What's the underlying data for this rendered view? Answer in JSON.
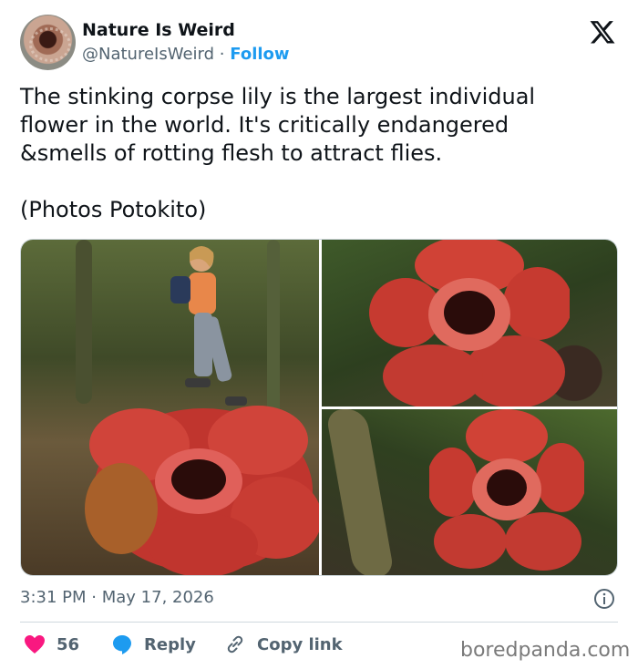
{
  "header": {
    "name": "Nature Is Weird",
    "handle": "@NatureIsWeird",
    "separator": "·",
    "follow_label": "Follow",
    "platform_icon": "x-logo-icon"
  },
  "tweet": {
    "lines": [
      "The stinking corpse lily is the largest individual",
      "flower in the world. It's critically endangered",
      "&smells of rotting flesh to attract flies."
    ],
    "credit": "(Photos Potokito)"
  },
  "media": {
    "photos": [
      {
        "icon": "rafflesia-with-woman-photo"
      },
      {
        "icon": "rafflesia-top-photo"
      },
      {
        "icon": "rafflesia-bottom-photo"
      }
    ]
  },
  "meta": {
    "time": "3:31 PM",
    "separator": "·",
    "date": "May 17, 2026",
    "info_icon": "info-icon"
  },
  "actions": {
    "like_count": "56",
    "reply_label": "Reply",
    "copy_label": "Copy link"
  },
  "watermark": "boredpanda.com",
  "colors": {
    "accent": "#1d9bf0",
    "like": "#f91880",
    "reply": "#1d9bf0",
    "text": "#0f1419",
    "muted": "#536471"
  }
}
